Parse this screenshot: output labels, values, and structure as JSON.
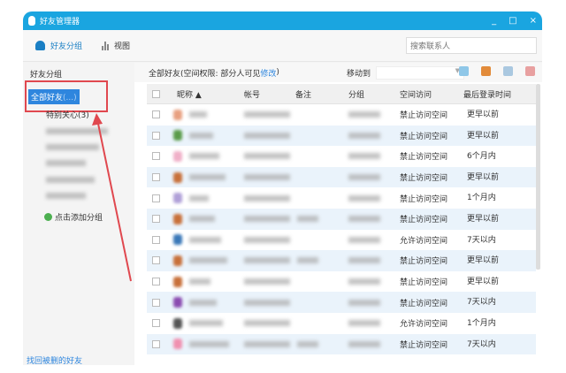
{
  "window": {
    "title": "好友管理器",
    "controls": [
      "_",
      "□",
      "×"
    ]
  },
  "toolbar": {
    "groups_label": "好友分组",
    "view_label": "视图",
    "search_placeholder": "搜索联系人"
  },
  "sidebar": {
    "header": "好友分组",
    "selected": "全部好友",
    "selected_count": "(...)",
    "special": "特别关心(3)",
    "add_group": "点击添加分组",
    "recover": "找回被删的好友"
  },
  "main": {
    "header_prefix": "全部好友(空间权限: 部分人可见",
    "header_link": "修改",
    "header_suffix": ")",
    "move_to": "移动到"
  },
  "columns": [
    "昵称 ▲",
    "帐号",
    "备注",
    "分组",
    "空间访问",
    "最后登录时间"
  ],
  "rows": [
    {
      "access": "禁止访问空间",
      "last": "更早以前"
    },
    {
      "access": "禁止访问空间",
      "last": "更早以前"
    },
    {
      "access": "禁止访问空间",
      "last": "6个月内"
    },
    {
      "access": "禁止访问空间",
      "last": "更早以前"
    },
    {
      "access": "禁止访问空间",
      "last": "1个月内"
    },
    {
      "access": "禁止访问空间",
      "last": "更早以前"
    },
    {
      "access": "允许访问空间",
      "last": "7天以内"
    },
    {
      "access": "禁止访问空间",
      "last": "更早以前"
    },
    {
      "access": "禁止访问空间",
      "last": "更早以前"
    },
    {
      "access": "禁止访问空间",
      "last": "7天以内"
    },
    {
      "access": "允许访问空间",
      "last": "1个月内"
    },
    {
      "access": "禁止访问空间",
      "last": "7天以内"
    }
  ],
  "colors": {
    "titlebar": "#1aa5e0",
    "selection": "#2e86de",
    "annotation": "#e0484f",
    "alt_row": "#eaf3fb"
  }
}
